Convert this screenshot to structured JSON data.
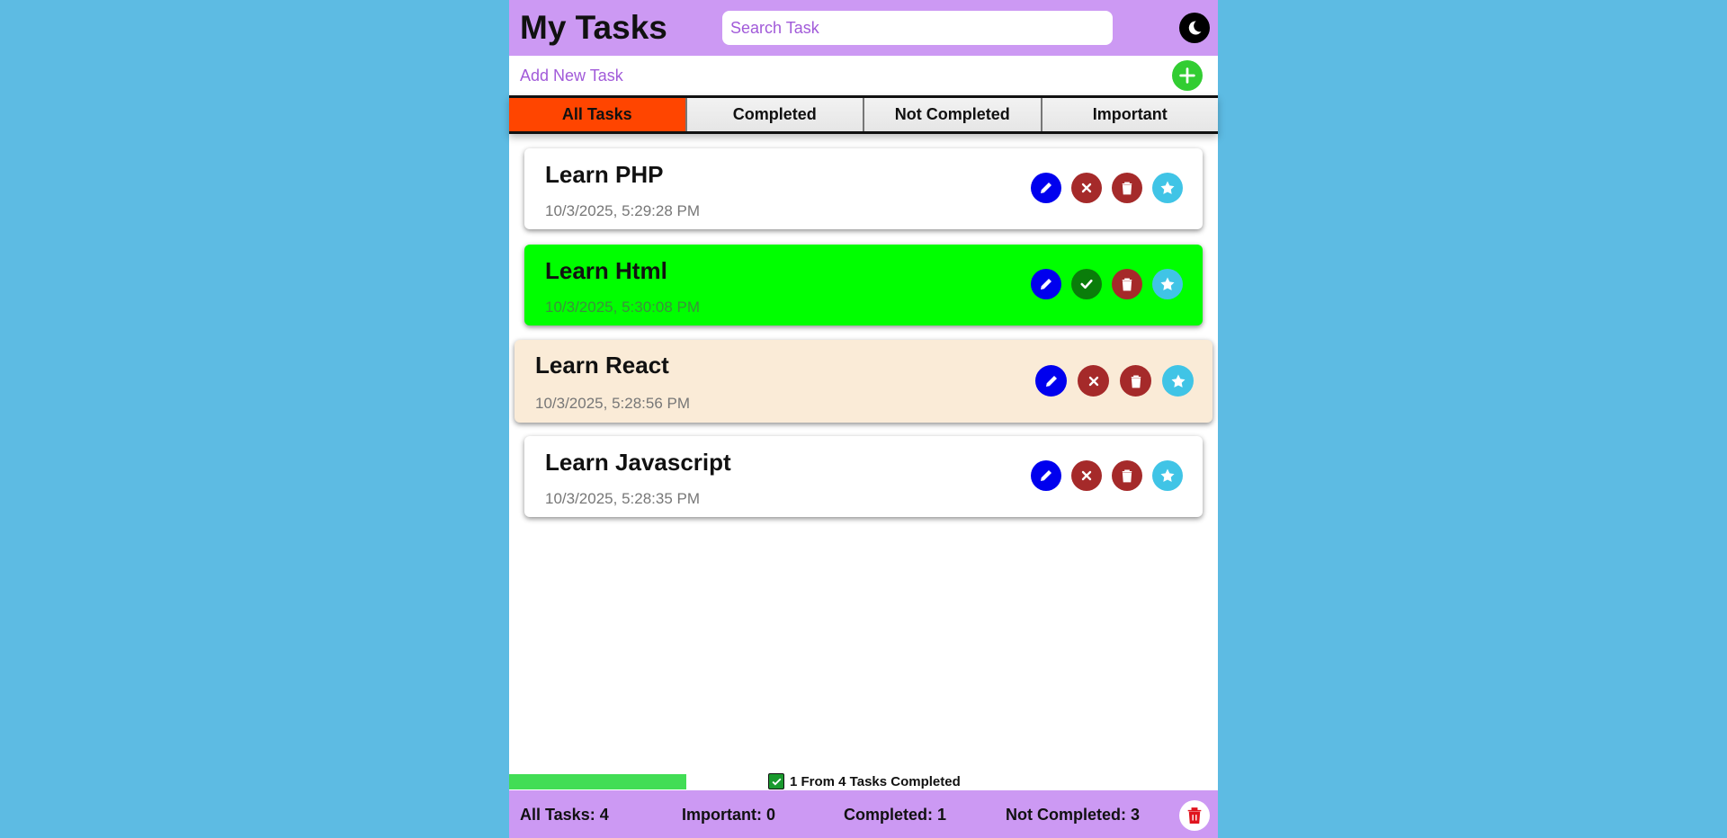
{
  "header": {
    "title": "My Tasks",
    "search_placeholder": "Search Task",
    "theme_icon": "moon-icon"
  },
  "add_task": {
    "placeholder": "Add New Task",
    "button_icon": "plus-icon"
  },
  "tabs": [
    {
      "label": "All Tasks",
      "active": true
    },
    {
      "label": "Completed",
      "active": false
    },
    {
      "label": "Not Completed",
      "active": false
    },
    {
      "label": "Important",
      "active": false
    }
  ],
  "tasks": [
    {
      "title": "Learn PHP",
      "date": "10/3/2025, 5:29:28 PM",
      "completed": false,
      "status_icon": "x-icon"
    },
    {
      "title": "Learn Html",
      "date": "10/3/2025, 5:30:08 PM",
      "completed": true,
      "status_icon": "check-icon"
    },
    {
      "title": "Learn React",
      "date": "10/3/2025, 5:28:56 PM",
      "completed": false,
      "status_icon": "x-icon"
    },
    {
      "title": "Learn Javascript",
      "date": "10/3/2025, 5:28:35 PM",
      "completed": false,
      "status_icon": "x-icon"
    }
  ],
  "progress": {
    "completed": 1,
    "total": 4,
    "fraction": 0.25,
    "label": "1 From 4 Tasks Completed"
  },
  "footer": {
    "all_tasks": "All Tasks: 4",
    "important": "Important: 0",
    "completed": "Completed: 1",
    "not_completed": "Not Completed: 3",
    "clear_icon": "trash-icon"
  },
  "colors": {
    "background": "#5dbbe3",
    "header": "#cc99f3",
    "active_tab": "#ff4500",
    "completed_task": "#00ff00",
    "hover_task": "#faebd7",
    "edit": "#0000ee",
    "delete": "#a52a2a",
    "star": "#40c4e6",
    "progress": "#42dd55"
  }
}
